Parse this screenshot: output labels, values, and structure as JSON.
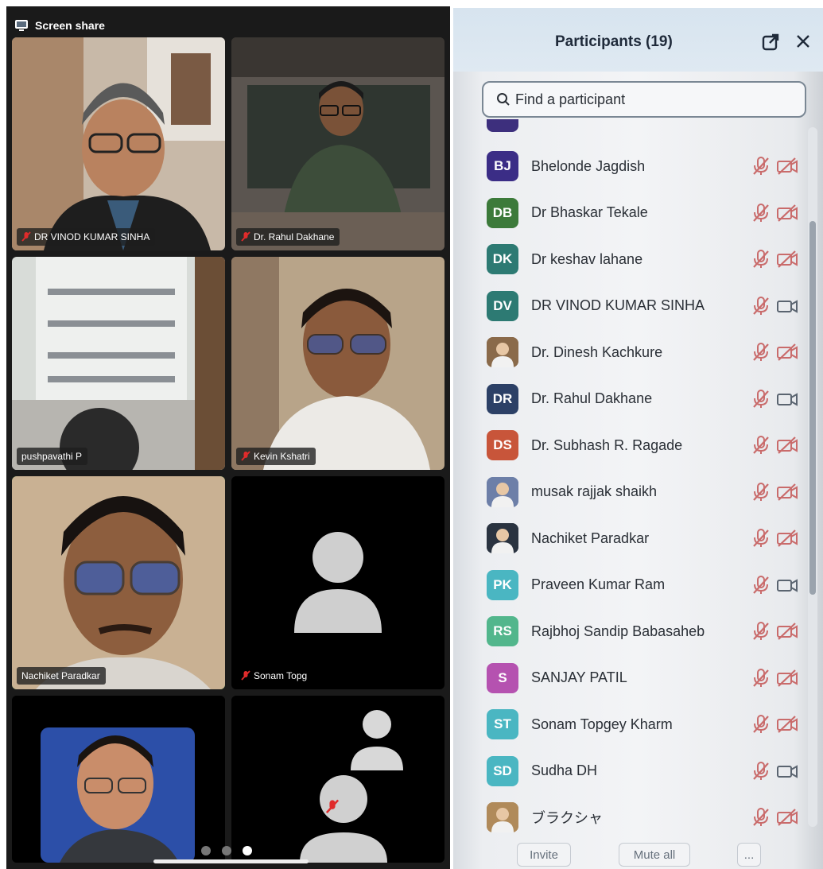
{
  "screen_share": {
    "label": "Screen share"
  },
  "tiles": [
    {
      "name": "DR VINOD KUMAR SINHA",
      "muted": true
    },
    {
      "name": "Dr. Rahul Dakhane",
      "muted": true
    },
    {
      "name": "pushpavathi P",
      "muted": false
    },
    {
      "name": "Kevin Kshatri",
      "muted": true
    },
    {
      "name": "Nachiket Paradkar",
      "muted": false
    },
    {
      "name": "Sonam Topg",
      "muted": true
    }
  ],
  "pager": {
    "pages": 3,
    "current": 3
  },
  "participants": {
    "title": "Participants (19)",
    "search_placeholder": "Find a participant",
    "items": [
      {
        "initials": "BJ",
        "name": "Bhelonde Jagdish",
        "color": "#3b2d86",
        "cam": "off"
      },
      {
        "initials": "DB",
        "name": "Dr Bhaskar Tekale",
        "color": "#3c7a3a",
        "cam": "off"
      },
      {
        "initials": "DK",
        "name": "Dr keshav lahane",
        "color": "#2d7a73",
        "cam": "off"
      },
      {
        "initials": "DV",
        "name": "DR VINOD KUMAR SINHA",
        "color": "#2d7a73",
        "cam": "on"
      },
      {
        "initials": "",
        "name": "Dr. Dinesh Kachkure",
        "color": "#8a6a4a",
        "cam": "off"
      },
      {
        "initials": "DR",
        "name": "Dr. Rahul Dakhane",
        "color": "#2c4066",
        "cam": "on"
      },
      {
        "initials": "DS",
        "name": "Dr. Subhash R. Ragade",
        "color": "#c8553a",
        "cam": "off"
      },
      {
        "initials": "",
        "name": "musak rajjak shaikh",
        "color": "#6d7fa8",
        "cam": "off"
      },
      {
        "initials": "",
        "name": "Nachiket Paradkar",
        "color": "#2a3340",
        "cam": "off"
      },
      {
        "initials": "PK",
        "name": "Praveen Kumar Ram",
        "color": "#4ab6c2",
        "cam": "on"
      },
      {
        "initials": "RS",
        "name": "Rajbhoj Sandip Babasaheb",
        "color": "#52b68c",
        "cam": "off"
      },
      {
        "initials": "S",
        "name": "SANJAY PATIL",
        "color": "#b552b0",
        "cam": "off"
      },
      {
        "initials": "ST",
        "name": "Sonam Topgey Kharm",
        "color": "#4ab6c2",
        "cam": "off"
      },
      {
        "initials": "SD",
        "name": "Sudha DH",
        "color": "#4ab6c2",
        "cam": "on"
      },
      {
        "initials": "",
        "name": "ブラクシャ",
        "color": "#b08a5a",
        "cam": "off"
      }
    ],
    "footer": {
      "invite": "Invite",
      "mute_all": "Mute all",
      "more": "..."
    }
  }
}
